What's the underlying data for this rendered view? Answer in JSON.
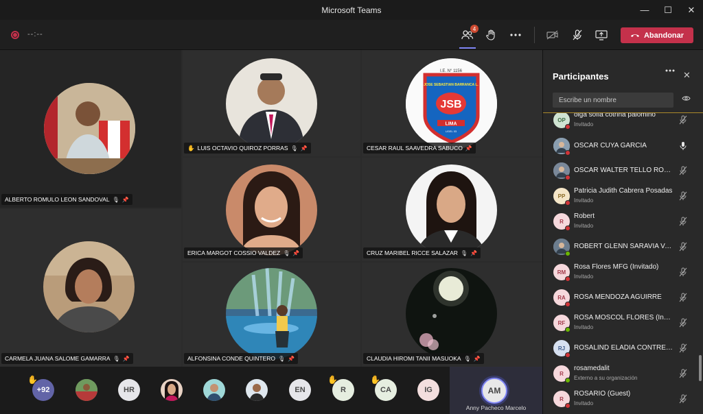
{
  "window": {
    "title": "Microsoft Teams",
    "minimize": "—",
    "maximize": "☐",
    "close": "✕"
  },
  "toolbar": {
    "timer": "--:--",
    "participants_badge": "4",
    "leave_label": "Abandonar"
  },
  "tiles": [
    {
      "name": "ALBERTO ROMULO LEON SANDOVAL",
      "hand": ""
    },
    {
      "name": "LUIS OCTAVIO QUIROZ PORRAS",
      "hand": "✋"
    },
    {
      "name": "CESAR RAUL SAAVEDRA SABUCO",
      "hand": ""
    },
    {
      "name": "ERICA MARGOT COSSIO VALDEZ",
      "hand": ""
    },
    {
      "name": "CRUZ MARIBEL RICCE SALAZAR",
      "hand": ""
    },
    {
      "name": "CARMELA JUANA SALOME GAMARRA",
      "hand": ""
    },
    {
      "name": "ALFONSINA CONDE QUINTERO",
      "hand": ""
    },
    {
      "name": "CLAUDIA HIROMI TANII MASUOKA",
      "hand": ""
    }
  ],
  "school_logo": {
    "top": "I.E. N° 1156",
    "arc": "JOSE SEBASTIAN BARRANCA L.",
    "initials": "JSB",
    "city": "LIMA",
    "sub": "UGEL 03"
  },
  "bottom_strip": {
    "overflow": "+92",
    "avatars": [
      "HR",
      "EN",
      "R",
      "CA",
      "IG"
    ],
    "active": {
      "initials": "AM",
      "name": "Anny Pacheco Marcelo"
    }
  },
  "panel": {
    "title": "Participantes",
    "search_placeholder": "Escribe un nombre",
    "participants": [
      {
        "initials": "OP",
        "name": "olga sofia cotrina palomino",
        "sub": "Invitado",
        "bg": "#cfe3d2",
        "fg": "#3e6b44",
        "status": "#d13438"
      },
      {
        "initials": "",
        "name": "OSCAR CUYA GARCIA",
        "sub": "",
        "bg": "#8a9eb0",
        "fg": "#fff",
        "status": "#d13438"
      },
      {
        "initials": "",
        "name": "OSCAR WALTER TELLO RODRIGUEZ",
        "sub": "",
        "bg": "#7a8899",
        "fg": "#fff",
        "status": "#d13438"
      },
      {
        "initials": "PP",
        "name": "Patricia Judith Cabrera Posadas",
        "sub": "Invitado",
        "bg": "#f5e6c8",
        "fg": "#8a6a24",
        "status": "#d13438"
      },
      {
        "initials": "R",
        "name": "Robert",
        "sub": "Invitado",
        "bg": "#f6d8dc",
        "fg": "#a33a4a",
        "status": "#d13438"
      },
      {
        "initials": "",
        "name": "ROBERT GLENN SARAVIA VALENCIA",
        "sub": "",
        "bg": "#6c7d8e",
        "fg": "#fff",
        "status": "#6bb700"
      },
      {
        "initials": "RM",
        "name": "Rosa Flores MFG (Invitado)",
        "sub": "Invitado",
        "bg": "#f6d8dc",
        "fg": "#a33a4a",
        "status": "#d13438"
      },
      {
        "initials": "RA",
        "name": "ROSA MENDOZA AGUIRRE",
        "sub": "",
        "bg": "#f6d8dc",
        "fg": "#a33a4a",
        "status": "#d13438"
      },
      {
        "initials": "RF",
        "name": "ROSA MOSCOL FLORES (Invitado)",
        "sub": "Invitado",
        "bg": "#f6d8dc",
        "fg": "#a33a4a",
        "status": "#6bb700"
      },
      {
        "initials": "RJ",
        "name": "ROSALIND ELADIA CONTRERAS",
        "sub": "",
        "bg": "#d6e0f0",
        "fg": "#3d5a8a",
        "status": "#d13438"
      },
      {
        "initials": "R",
        "name": "rosamedalit",
        "sub": "Externo a su organización",
        "bg": "#f6d8dc",
        "fg": "#a33a4a",
        "status": "#6bb700"
      },
      {
        "initials": "R",
        "name": "ROSARIO (Guest)",
        "sub": "Invitado",
        "bg": "#f6d8dc",
        "fg": "#a33a4a",
        "status": "#d13438"
      }
    ]
  }
}
